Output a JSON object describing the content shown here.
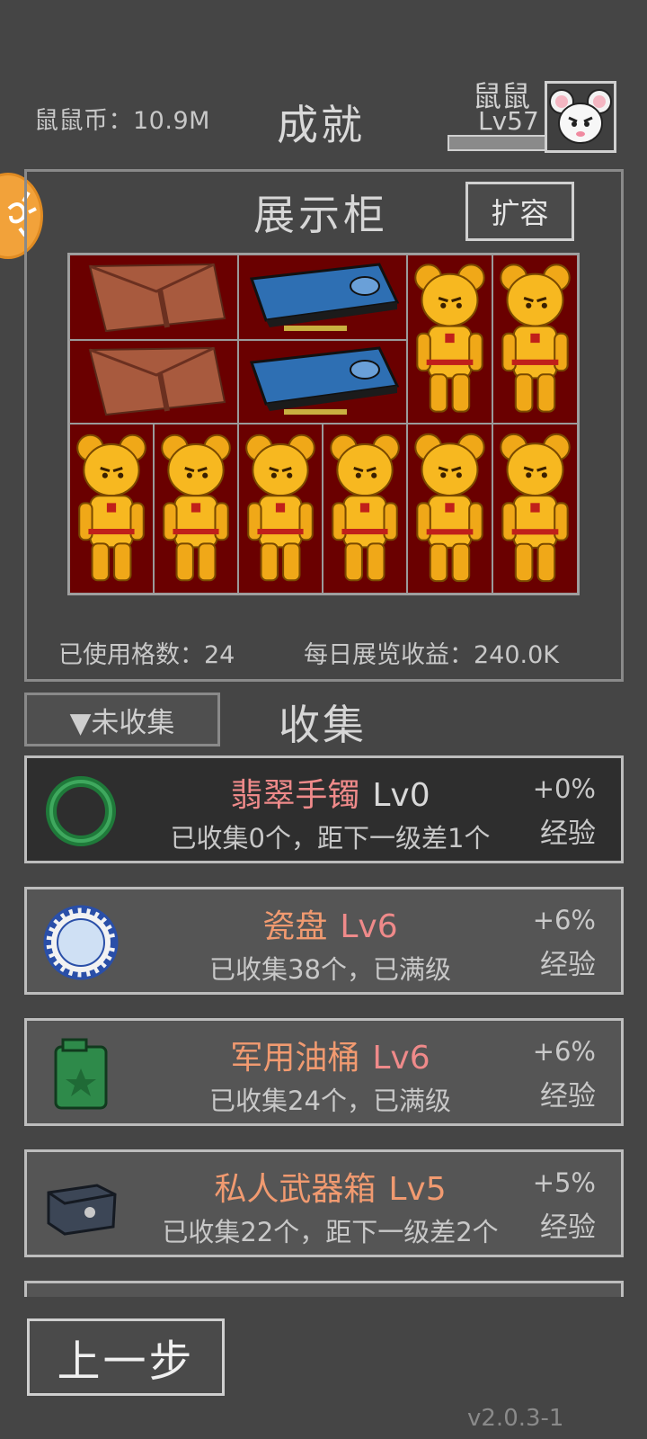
{
  "header": {
    "coins_text": "鼠鼠币：10.9M",
    "title": "成就",
    "player_name": "鼠鼠",
    "player_level": "Lv57"
  },
  "showcase": {
    "title": "展示柜",
    "expand_label": "扩容",
    "used_cells_text": "已使用格数：24",
    "daily_income_text": "每日展览收益：240.0K",
    "items": [
      "wallet-icon",
      "graphics-card-icon",
      "gold-bear-icon",
      "gold-bear-icon",
      "wallet-icon",
      "graphics-card-icon",
      "gold-bear-icon",
      "gold-bear-icon",
      "gold-bear-icon",
      "gold-bear-icon",
      "gold-bear-icon",
      "gold-bear-icon"
    ]
  },
  "collection": {
    "filter_label": "▼未收集",
    "title": "收集",
    "rows": [
      {
        "icon": "jade-bracelet-icon",
        "name": "翡翠手镯",
        "level": "Lv0",
        "status": "已收集0个，距下一级差1个",
        "bonus": "+0%",
        "exp_label": "经验"
      },
      {
        "icon": "porcelain-plate-icon",
        "name": "瓷盘",
        "level": "Lv6",
        "status": "已收集38个，已满级",
        "bonus": "+6%",
        "exp_label": "经验"
      },
      {
        "icon": "jerry-can-icon",
        "name": "军用油桶",
        "level": "Lv6",
        "status": "已收集24个，已满级",
        "bonus": "+6%",
        "exp_label": "经验"
      },
      {
        "icon": "weapon-case-icon",
        "name": "私人武器箱",
        "level": "Lv5",
        "status": "已收集22个，距下一级差2个",
        "bonus": "+5%",
        "exp_label": "经验"
      }
    ]
  },
  "footer": {
    "back_label": "上一步",
    "version": "v2.0.3-1"
  },
  "colors": {
    "background": "#454545",
    "showcase_cell": "#6a0000",
    "item_name": "#ef8a8a",
    "accent_orange": "#f2a23a"
  }
}
